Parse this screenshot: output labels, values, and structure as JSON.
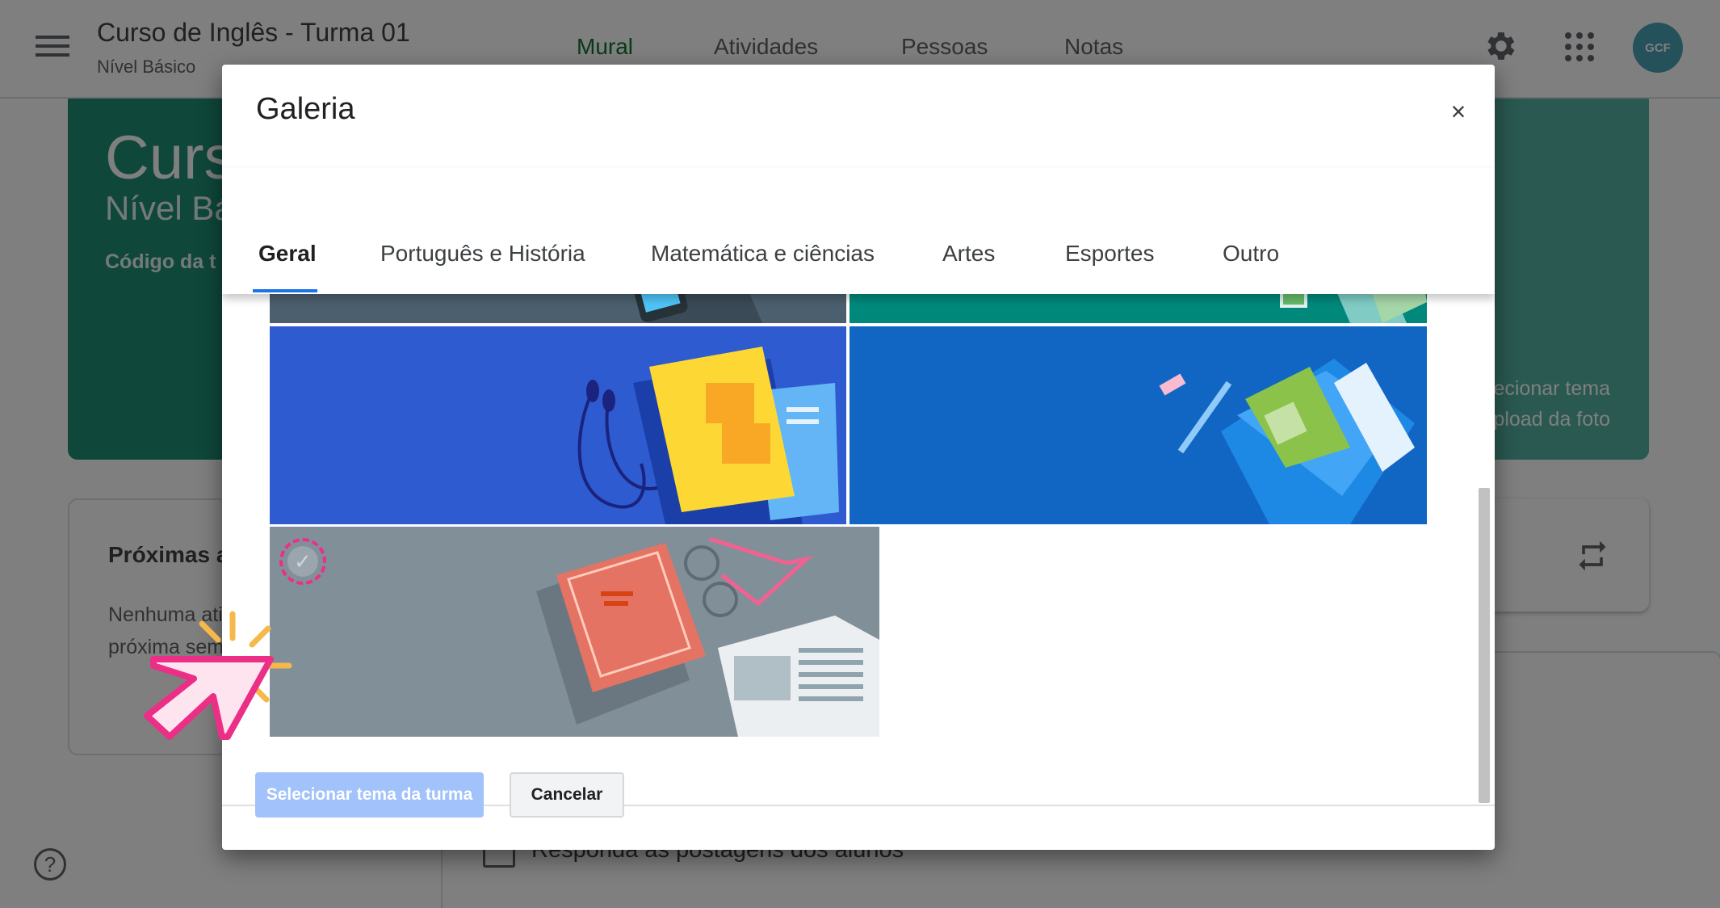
{
  "app": {
    "course_title": "Curso de Inglês - Turma 01",
    "course_subtitle": "Nível Básico",
    "nav_tabs": [
      "Mural",
      "Atividades",
      "Pessoas",
      "Notas"
    ],
    "active_tab": "Mural",
    "avatar_text": "GCF"
  },
  "banner": {
    "title_partial": "Curs",
    "subtitle_partial": "Nível Bá",
    "code_partial": "Código da t",
    "hint_line1": "ecionar tema",
    "hint_line2": "pload da foto",
    "accent_color": "#1e8e77"
  },
  "upcoming": {
    "title_partial": "Próximas a",
    "text_line1": "Nenhuma ati",
    "text_line2": "próxima sem"
  },
  "feed": {
    "text": "Responda às postagens dos alunos"
  },
  "dialog": {
    "title": "Galeria",
    "close_label": "×",
    "tabs": [
      "Geral",
      "Português e História",
      "Matemática e ciências",
      "Artes",
      "Esportes",
      "Outro"
    ],
    "active_tab": "Geral",
    "themes": [
      {
        "name": "laptop-tablet-theme",
        "color": "#4b5f6e"
      },
      {
        "name": "phone-notebook-theme",
        "color": "#00897b"
      },
      {
        "name": "books-headphones-theme",
        "color": "#2e5bd0"
      },
      {
        "name": "backpack-pencil-theme",
        "color": "#1166c4"
      },
      {
        "name": "book-glasses-newspaper-theme",
        "color": "#818f99",
        "selected": true
      }
    ],
    "primary_button": "Selecionar tema da turma",
    "cancel_button": "Cancelar"
  },
  "help_label": "?"
}
